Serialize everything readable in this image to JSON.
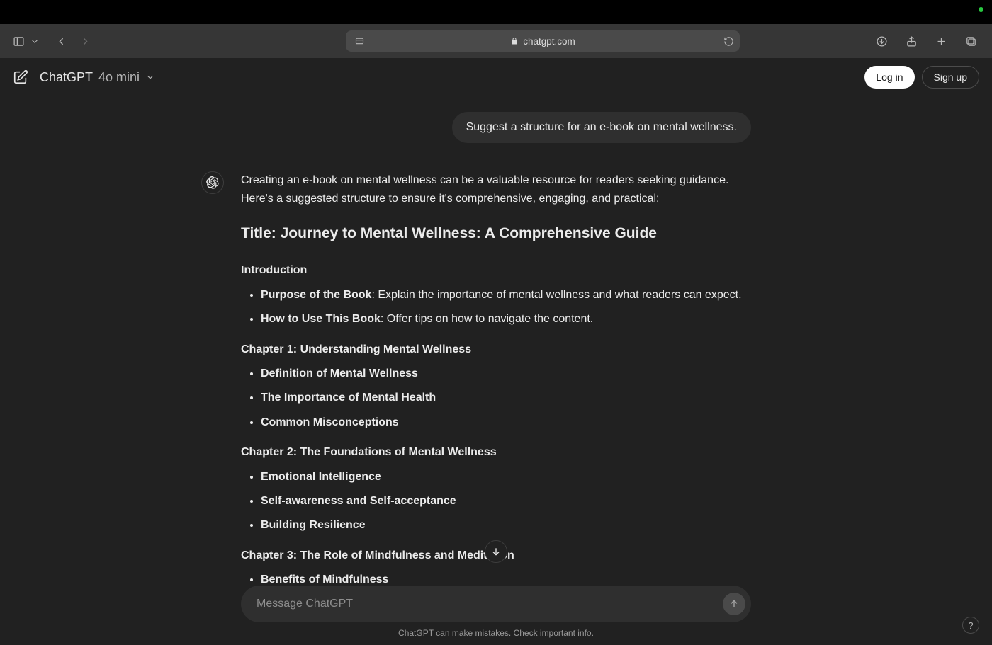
{
  "browser": {
    "url_host": "chatgpt.com"
  },
  "header": {
    "model_primary": "ChatGPT",
    "model_secondary": "4o mini",
    "login_label": "Log in",
    "signup_label": "Sign up"
  },
  "conversation": {
    "user_message": "Suggest a structure for an e-book on mental wellness.",
    "intro_paragraph": "Creating an e-book on mental wellness can be a valuable resource for readers seeking guidance. Here's a suggested structure to ensure it's comprehensive, engaging, and practical:",
    "title_prefix": "Title: ",
    "title_text": "Journey to Mental Wellness: A Comprehensive Guide",
    "sections": {
      "intro": {
        "heading": "Introduction",
        "items": [
          {
            "bold": "Purpose of the Book",
            "rest": ": Explain the importance of mental wellness and what readers can expect."
          },
          {
            "bold": "How to Use This Book",
            "rest": ": Offer tips on how to navigate the content."
          }
        ]
      },
      "ch1": {
        "heading": "Chapter 1: Understanding Mental Wellness",
        "items": [
          {
            "bold": "Definition of Mental Wellness",
            "rest": ""
          },
          {
            "bold": "The Importance of Mental Health",
            "rest": ""
          },
          {
            "bold": "Common Misconceptions",
            "rest": ""
          }
        ]
      },
      "ch2": {
        "heading": "Chapter 2: The Foundations of Mental Wellness",
        "items": [
          {
            "bold": "Emotional Intelligence",
            "rest": ""
          },
          {
            "bold": "Self-awareness and Self-acceptance",
            "rest": ""
          },
          {
            "bold": "Building Resilience",
            "rest": ""
          }
        ]
      },
      "ch3": {
        "heading": "Chapter 3: The Role of Mindfulness and Meditation",
        "items": [
          {
            "bold": "Benefits of Mindfulness",
            "rest": ""
          }
        ]
      }
    }
  },
  "composer": {
    "placeholder": "Message ChatGPT"
  },
  "footer": {
    "disclaimer": "ChatGPT can make mistakes. Check important info."
  },
  "help": {
    "label": "?"
  }
}
